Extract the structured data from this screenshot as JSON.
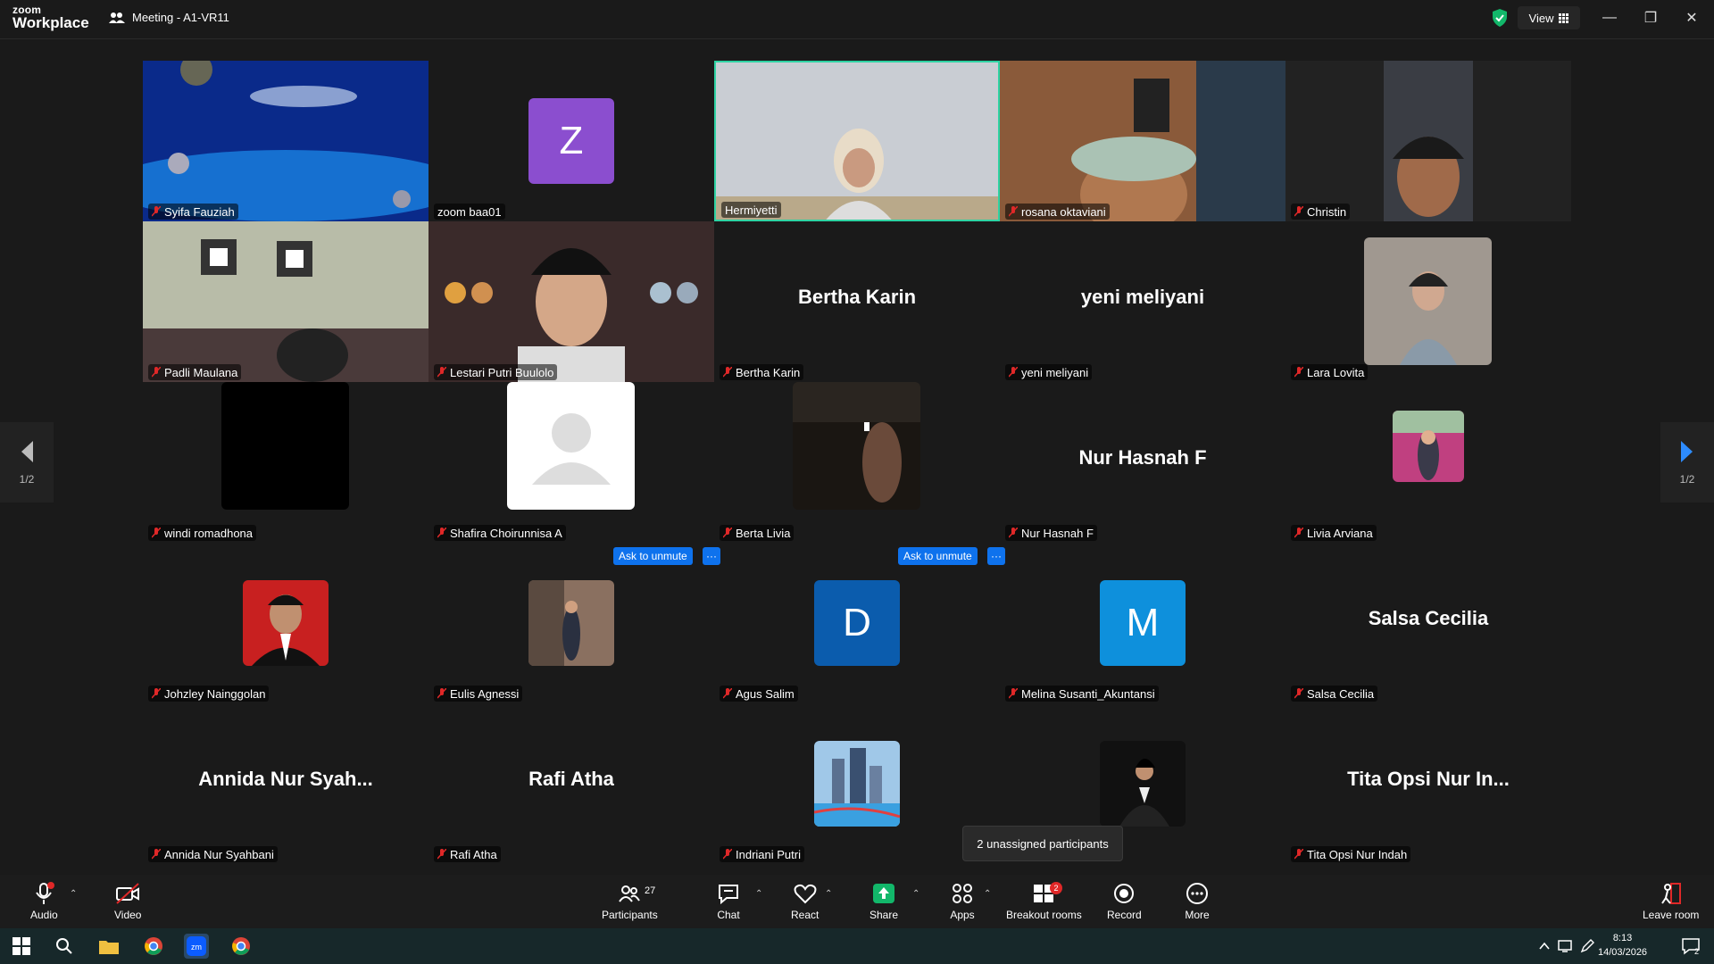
{
  "app": {
    "logo_small": "zoom",
    "logo_big": "Workplace",
    "meeting_title": "Meeting - A1-VR11",
    "view_label": "View"
  },
  "tiles": [
    {
      "name": "Syifa Fauziah",
      "muted": true
    },
    {
      "name": "zoom baa01",
      "muted": false,
      "initial": "Z"
    },
    {
      "name": "Hermiyetti",
      "muted": false
    },
    {
      "name": "rosana oktaviani",
      "muted": true
    },
    {
      "name": "Christin",
      "muted": true
    },
    {
      "name": "Padli Maulana",
      "muted": true
    },
    {
      "name": "Lestari Putri Buulolo",
      "muted": true
    },
    {
      "name": "Bertha Karin",
      "muted": true,
      "display": "Bertha Karin"
    },
    {
      "name": "yeni meliyani",
      "muted": true,
      "display": "yeni meliyani"
    },
    {
      "name": "Lara Lovita",
      "muted": true
    },
    {
      "name": "windi romadhona",
      "muted": true
    },
    {
      "name": "Shafira Choirunnisa A",
      "muted": true
    },
    {
      "name": "Berta Livia",
      "muted": true
    },
    {
      "name": "Nur Hasnah F",
      "muted": true,
      "display": "Nur Hasnah F"
    },
    {
      "name": "Livia Arviana",
      "muted": true
    },
    {
      "name": "Johzley Nainggolan",
      "muted": true
    },
    {
      "name": "Eulis Agnessi",
      "muted": true
    },
    {
      "name": "Agus Salim",
      "muted": true,
      "initial": "D"
    },
    {
      "name": "Melina Susanti_Akuntansi",
      "muted": true,
      "initial": "M"
    },
    {
      "name": "Salsa Cecilia",
      "muted": true,
      "display": "Salsa Cecilia"
    },
    {
      "name": "Annida Nur Syahbani",
      "muted": true,
      "display": "Annida  Nur  Syah..."
    },
    {
      "name": "Rafi Atha",
      "muted": true,
      "display": "Rafi Atha"
    },
    {
      "name": "Indriani Putri",
      "muted": true
    },
    {
      "name": "",
      "muted": false
    },
    {
      "name": "Tita Opsi Nur Indah",
      "muted": true,
      "display": "Tita Opsi Nur In..."
    }
  ],
  "ask_unmute": "Ask to unmute",
  "ask_more": "···",
  "page_indicator": "1/2",
  "tooltip": "2 unassigned participants",
  "toolbar": {
    "audio": "Audio",
    "video": "Video",
    "participants": "Participants",
    "participants_count": "27",
    "chat": "Chat",
    "react": "React",
    "share": "Share",
    "apps": "Apps",
    "breakout": "Breakout rooms",
    "breakout_badge": "2",
    "record": "Record",
    "more": "More",
    "leave": "Leave room"
  },
  "taskbar": {
    "time": "8:13",
    "date": "14/03/2026",
    "notif_count": "2"
  },
  "colors": {
    "accent": "#0e72ed",
    "active_border": "#2ed3a3",
    "mic_off": "#e02828",
    "share": "#12b76a"
  }
}
